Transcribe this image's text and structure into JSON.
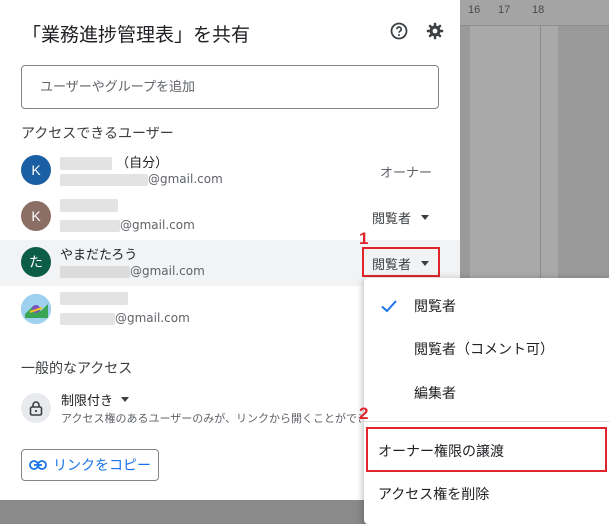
{
  "background": {
    "ruler_marks": [
      "16",
      "17",
      "18"
    ]
  },
  "dialog": {
    "title": "「業務進捗管理表」を共有",
    "search_placeholder": "ユーザーやグループを追加",
    "people_section_title": "アクセスできるユーザー",
    "users": [
      {
        "avatar_letter": "K",
        "avatar_color": "#1a5fa3",
        "name_suffix": "（自分）",
        "email_suffix": "@gmail.com",
        "role": "オーナー"
      },
      {
        "avatar_letter": "K",
        "avatar_color": "#8b6f66",
        "name_suffix": "",
        "email_suffix": "@gmail.com",
        "role": "閲覧者"
      },
      {
        "avatar_letter": "た",
        "avatar_color": "#0b5d47",
        "name": "やまだたろう",
        "email_suffix": "@gmail.com",
        "role": "閲覧者"
      },
      {
        "avatar_letter": "",
        "avatar_color": "#7bb6e8",
        "name_suffix": "",
        "email_suffix": "@gmail.com",
        "role": ""
      }
    ],
    "general_access_title": "一般的なアクセス",
    "restricted_label": "制限付き",
    "restricted_desc": "アクセス権のあるユーザーのみが、リンクから開くことができ",
    "copy_link_label": "リンクをコピー"
  },
  "menu": {
    "items": [
      {
        "label": "閲覧者",
        "checked": true
      },
      {
        "label": "閲覧者（コメント可）",
        "checked": false
      },
      {
        "label": "編集者",
        "checked": false
      },
      {
        "label": "オーナー権限の譲渡",
        "checked": false
      },
      {
        "label": "アクセス権を削除",
        "checked": false
      }
    ]
  },
  "annotations": {
    "step1": "1",
    "step2": "2",
    "color": "#e0242b"
  }
}
